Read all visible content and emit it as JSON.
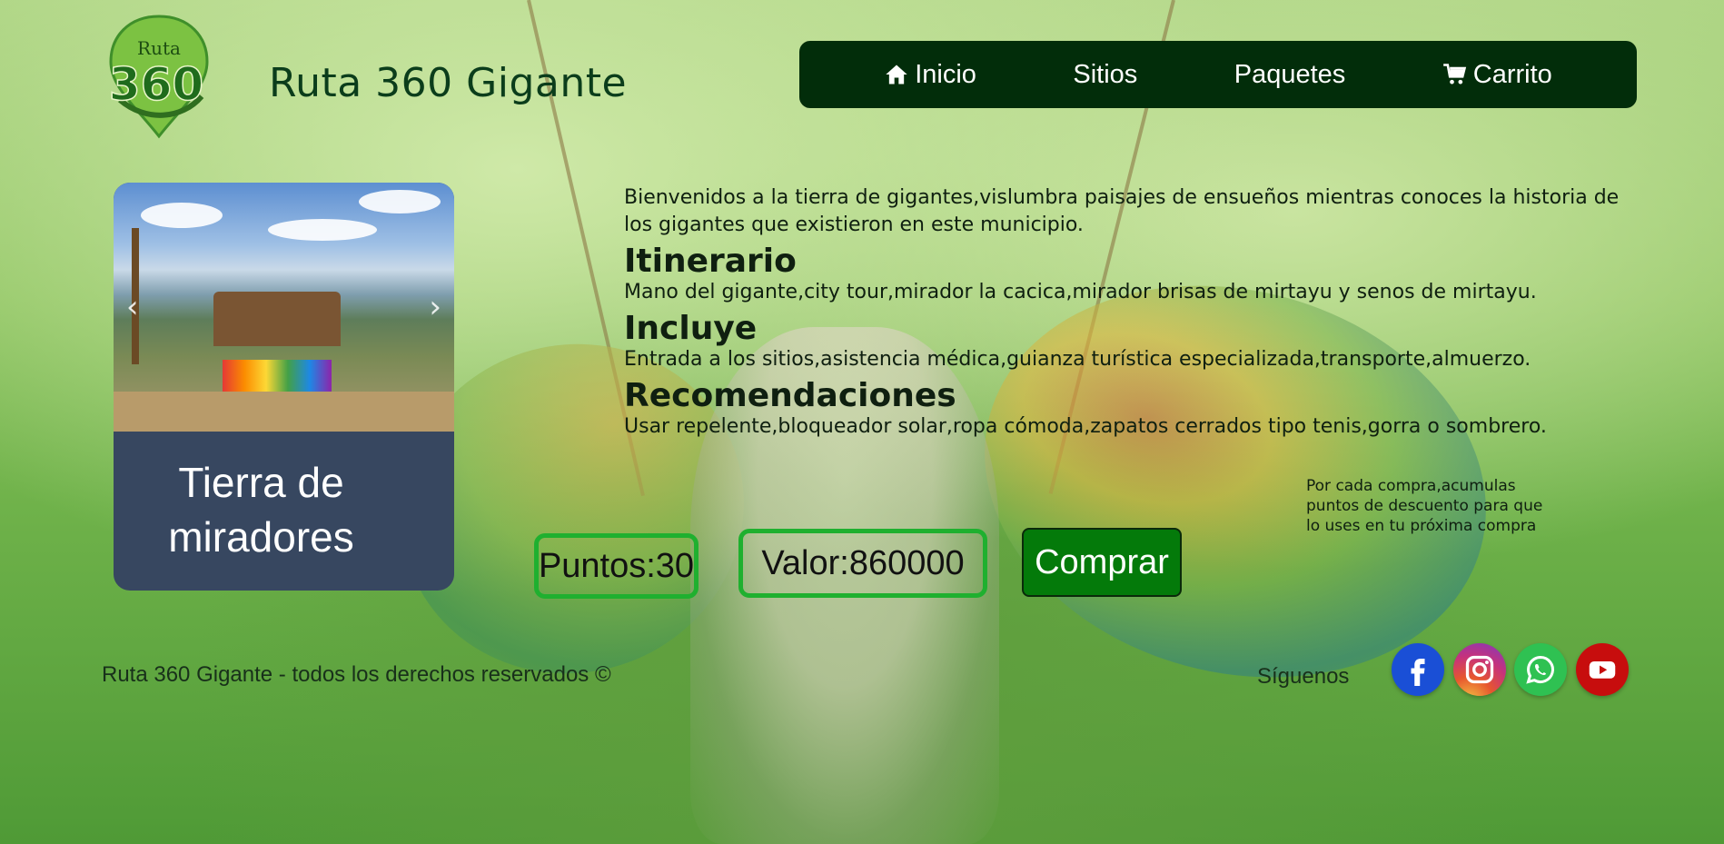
{
  "header": {
    "logo_text_top": "Ruta",
    "logo_text_main": "360",
    "title": "Ruta 360 Gigante"
  },
  "nav": {
    "items": [
      {
        "label": "Inicio",
        "icon": "home-icon"
      },
      {
        "label": "Sitios"
      },
      {
        "label": "Paquetes"
      },
      {
        "label": "Carrito",
        "icon": "cart-icon"
      }
    ]
  },
  "card": {
    "title": "Tierra de miradores",
    "prev_arrow": "‹",
    "next_arrow": "›"
  },
  "content": {
    "intro": "Bienvenidos a la tierra de gigantes,vislumbra paisajes de ensueños mientras conoces la historia de los gigantes que existieron en este municipio.",
    "sections": [
      {
        "heading": "Itinerario",
        "text": "Mano del gigante,city tour,mirador la cacica,mirador brisas de mirtayu y senos de mirtayu."
      },
      {
        "heading": "Incluye",
        "text": "Entrada a los sitios,asistencia médica,guianza turística especializada,transporte,almuerzo."
      },
      {
        "heading": "Recomendaciones",
        "text": "Usar repelente,bloqueador solar,ropa cómoda,zapatos cerrados tipo tenis,gorra o sombrero."
      }
    ]
  },
  "points_note": "Por cada compra,acumulas puntos de descuento para que lo uses en tu próxima compra",
  "purchase": {
    "points_label": "Puntos:30",
    "value_label": "Valor:860000",
    "buy_label": "Comprar"
  },
  "footer": {
    "copyright": "Ruta 360 Gigante - todos los derechos reservados ©",
    "follow": "Síguenos",
    "social": [
      "facebook-icon",
      "instagram-icon",
      "whatsapp-icon",
      "youtube-icon"
    ]
  },
  "colors": {
    "nav_bg": "#022d0a",
    "card_bg": "#374760",
    "pill_border": "#1fb02f",
    "buy_bg": "#047a0a",
    "title": "#0b3d1b"
  }
}
